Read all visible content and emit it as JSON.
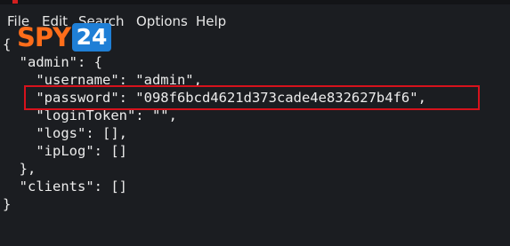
{
  "menu": {
    "items": [
      "File",
      "Edit",
      "Search",
      "Options",
      "Help"
    ]
  },
  "editor": {
    "lines": [
      "{",
      "  \"admin\": {",
      "    \"username\": \"admin\",",
      "    \"password\": \"098f6bcd4621d373cade4e832627b4f6\",",
      "    \"loginToken\": \"\",",
      "    \"logs\": [],",
      "    \"ipLog\": []",
      "  },",
      "  \"clients\": []",
      "}"
    ]
  },
  "highlight": {
    "target_line": "password",
    "color": "#d6121c"
  },
  "watermark": {
    "brand_text": "SPY",
    "brand_number": "24",
    "brand_color": "#ff6d1a",
    "number_bg_color": "#1f7fd6"
  }
}
